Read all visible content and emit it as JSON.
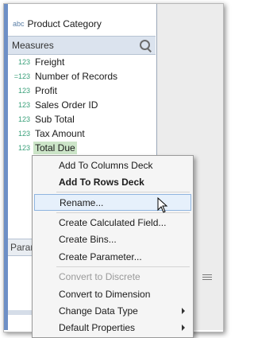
{
  "dimensions_top": {
    "icon": "abc",
    "label": "Product Category"
  },
  "measures": {
    "header": "Measures",
    "items": [
      {
        "type_icon": "123",
        "label": "Freight"
      },
      {
        "type_icon": "=123",
        "label": "Number of Records"
      },
      {
        "type_icon": "123",
        "label": "Profit"
      },
      {
        "type_icon": "123",
        "label": "Sales Order ID"
      },
      {
        "type_icon": "123",
        "label": "Sub Total"
      },
      {
        "type_icon": "123",
        "label": "Tax Amount"
      },
      {
        "type_icon": "123",
        "label": "Total Due"
      }
    ]
  },
  "parameters": {
    "header": "Param"
  },
  "context_menu": {
    "items": [
      "Add To Columns Deck",
      "Add To Rows Deck",
      "Rename...",
      "Create Calculated Field...",
      "Create Bins...",
      "Create Parameter...",
      "Convert to Discrete",
      "Convert to Dimension",
      "Change Data Type",
      "Default Properties"
    ]
  },
  "colors": {
    "selected_highlight": "#cce5c8",
    "hover_highlight": "#e6f0fb",
    "measure_icon": "#3aa07a",
    "dimension_icon": "#5b7fa6"
  }
}
